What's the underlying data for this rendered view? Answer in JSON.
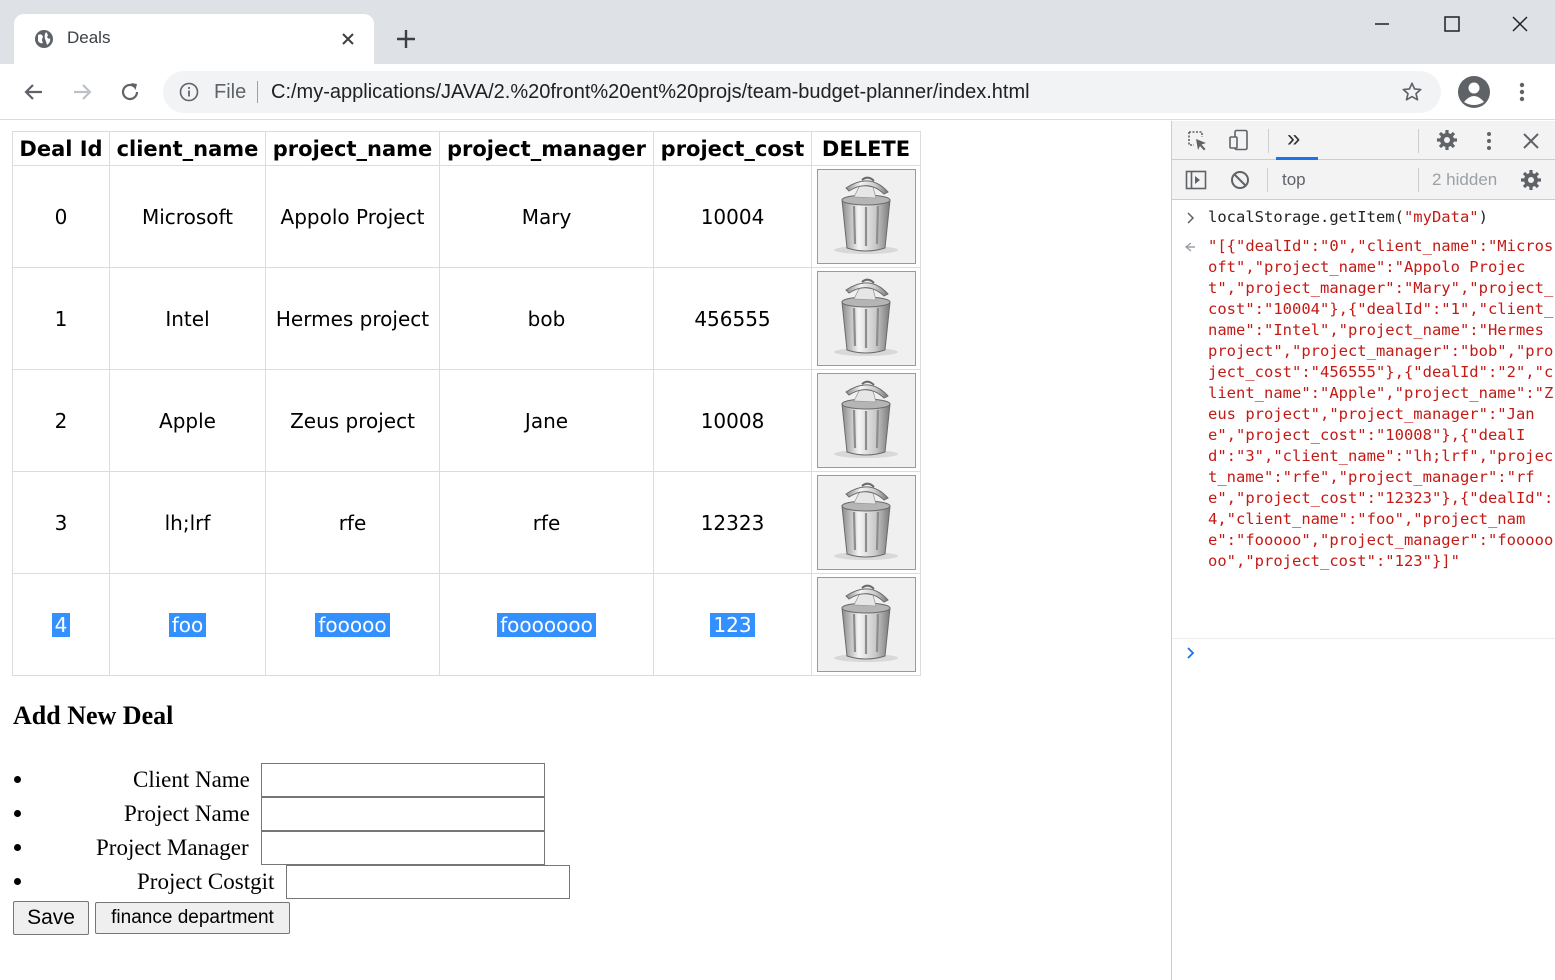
{
  "browser": {
    "tab_title": "Deals",
    "omnibox": {
      "scheme_label": "File",
      "url": "C:/my-applications/JAVA/2.%20front%20ent%20projs/team-budget-planner/index.html"
    },
    "icons": [
      "globe-icon",
      "close-icon",
      "plus-icon",
      "minimize-icon",
      "maximize-icon",
      "back-icon",
      "forward-icon",
      "reload-icon",
      "info-icon",
      "star-icon",
      "profile-icon",
      "more-icon"
    ]
  },
  "deals_table": {
    "headers": [
      "Deal Id",
      "client_name",
      "project_name",
      "project_manager",
      "project_cost",
      "DELETE"
    ],
    "rows": [
      {
        "deal_id": "0",
        "client_name": "Microsoft",
        "project_name": "Appolo Project",
        "project_manager": "Mary",
        "project_cost": "10004"
      },
      {
        "deal_id": "1",
        "client_name": "Intel",
        "project_name": "Hermes project",
        "project_manager": "bob",
        "project_cost": "456555"
      },
      {
        "deal_id": "2",
        "client_name": "Apple",
        "project_name": "Zeus project",
        "project_manager": "Jane",
        "project_cost": "10008"
      },
      {
        "deal_id": "3",
        "client_name": "lh;lrf",
        "project_name": "rfe",
        "project_manager": "rfe",
        "project_cost": "12323"
      },
      {
        "deal_id": "4",
        "client_name": "foo",
        "project_name": "fooooo",
        "project_manager": "fooooooo",
        "project_cost": "123"
      }
    ],
    "selected_row_index": 4,
    "selection_color": "#3390ff"
  },
  "form": {
    "title": "Add New Deal",
    "fields": [
      {
        "label": "Client Name",
        "value": ""
      },
      {
        "label": "Project Name",
        "value": ""
      },
      {
        "label": "Project Manager",
        "value": ""
      },
      {
        "label": "Project Costgit",
        "value": ""
      }
    ],
    "save_label": "Save",
    "finance_label": "finance department"
  },
  "devtools": {
    "more_tabs_label": "»",
    "context": "top",
    "hidden_count": "2 hidden",
    "command_prefix": "localStorage.getItem(",
    "command_arg": "\"myData\"",
    "command_suffix": ")",
    "output": "\"[{\"dealId\":\"0\",\"client_name\":\"Microsoft\",\"project_name\":\"Appolo Project\",\"project_manager\":\"Mary\",\"project_cost\":\"10004\"},{\"dealId\":\"1\",\"client_name\":\"Intel\",\"project_name\":\"Hermes project\",\"project_manager\":\"bob\",\"project_cost\":\"456555\"},{\"dealId\":\"2\",\"client_name\":\"Apple\",\"project_name\":\"Zeus project\",\"project_manager\":\"Jane\",\"project_cost\":\"10008\"},{\"dealId\":\"3\",\"client_name\":\"lh;lrf\",\"project_name\":\"rfe\",\"project_manager\":\"rfe\",\"project_cost\":\"12323\"},{\"dealId\":4,\"client_name\":\"foo\",\"project_name\":\"fooooo\",\"project_manager\":\"fooooooo\",\"project_cost\":\"123\"}]\"",
    "accent_color": "#1a73e8",
    "string_color": "#c41a16"
  }
}
